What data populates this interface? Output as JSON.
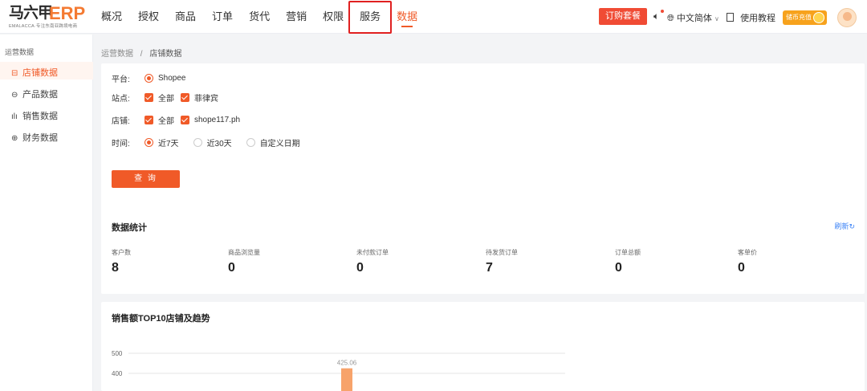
{
  "logo": {
    "cn": "马六甲",
    "erp": "ERP",
    "sub": "EMALACCA·专注东南亚跨境电商"
  },
  "nav": {
    "items": [
      "概况",
      "授权",
      "商品",
      "订单",
      "货代",
      "营销",
      "权限",
      "服务",
      "数据"
    ],
    "active_index": 8
  },
  "header": {
    "buy_label": "订购套餐",
    "lang_label": "中文简体",
    "tutorial_label": "使用教程",
    "recharge_label": "储币充值"
  },
  "sidebar": {
    "title": "运营数据",
    "items": [
      {
        "label": "店铺数据",
        "icon": "store-icon",
        "active": true
      },
      {
        "label": "产品数据",
        "icon": "product-icon",
        "active": false
      },
      {
        "label": "销售数据",
        "icon": "sales-chart-icon",
        "active": false
      },
      {
        "label": "财务数据",
        "icon": "finance-icon",
        "active": false
      }
    ]
  },
  "breadcrumb": {
    "parent": "运营数据",
    "sep": "/",
    "current": "店铺数据"
  },
  "filter": {
    "platform_label": "平台:",
    "platform_value": "Shopee",
    "site_label": "站点:",
    "site_all": "全部",
    "site_value": "菲律宾",
    "store_label": "店铺:",
    "store_all": "全部",
    "store_value": "shope117.ph",
    "time_label": "时间:",
    "time_options": [
      "近7天",
      "近30天",
      "自定义日期"
    ],
    "time_selected": 0,
    "query_label": "查 询"
  },
  "stats": {
    "title": "数据统计",
    "refresh_label": "刷新",
    "items": [
      {
        "label": "客户数",
        "value": "8"
      },
      {
        "label": "商品浏览量",
        "value": "0"
      },
      {
        "label": "未付款订单",
        "value": "0"
      },
      {
        "label": "待发货订单",
        "value": "7"
      },
      {
        "label": "订单总额",
        "value": "0"
      },
      {
        "label": "客单价",
        "value": "0"
      }
    ]
  },
  "chart_card": {
    "title": "销售额TOP10店铺及趋势"
  },
  "chart_data": {
    "type": "bar",
    "categories": [
      ""
    ],
    "values": [
      425.06
    ],
    "data_labels": [
      "425.06"
    ],
    "yticks": [
      "500",
      "400"
    ],
    "ylim": [
      0,
      500
    ]
  },
  "colors": {
    "accent": "#f05a28",
    "buy_button": "#f04b34",
    "link": "#3b82f6",
    "bar": "#f7a36b"
  }
}
